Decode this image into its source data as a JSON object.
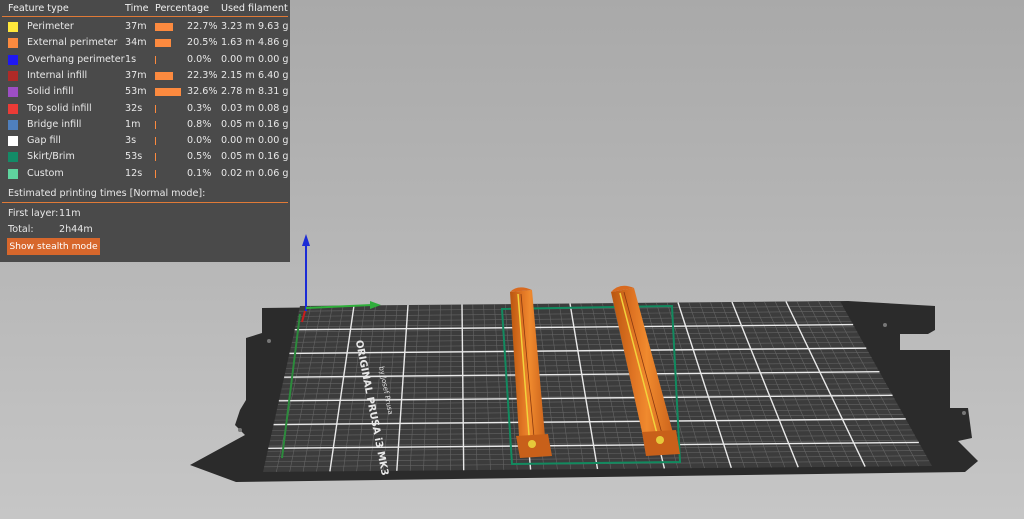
{
  "legend": {
    "headers": {
      "feature_type": "Feature type",
      "time": "Time",
      "percentage": "Percentage",
      "used_filament": "Used filament"
    },
    "rows": [
      {
        "name": "Perimeter",
        "color": "#ffe83b",
        "time": "37m",
        "percent": "22.7%",
        "length": "3.23 m",
        "weight": "9.63 g"
      },
      {
        "name": "External perimeter",
        "color": "#fc8a3f",
        "time": "34m",
        "percent": "20.5%",
        "length": "1.63 m",
        "weight": "4.86 g"
      },
      {
        "name": "Overhang perimeter",
        "color": "#1f18f0",
        "time": "1s",
        "percent": "0.0%",
        "length": "0.00 m",
        "weight": "0.00 g"
      },
      {
        "name": "Internal infill",
        "color": "#b02a27",
        "time": "37m",
        "percent": "22.3%",
        "length": "2.15 m",
        "weight": "6.40 g"
      },
      {
        "name": "Solid infill",
        "color": "#9d4ec4",
        "time": "53m",
        "percent": "32.6%",
        "length": "2.78 m",
        "weight": "8.31 g"
      },
      {
        "name": "Top solid infill",
        "color": "#eb3b36",
        "time": "32s",
        "percent": "0.3%",
        "length": "0.03 m",
        "weight": "0.08 g"
      },
      {
        "name": "Bridge infill",
        "color": "#4f7fbd",
        "time": "1m",
        "percent": "0.8%",
        "length": "0.05 m",
        "weight": "0.16 g"
      },
      {
        "name": "Gap fill",
        "color": "#ffffff",
        "time": "3s",
        "percent": "0.0%",
        "length": "0.00 m",
        "weight": "0.00 g"
      },
      {
        "name": "Skirt/Brim",
        "color": "#138b67",
        "time": "53s",
        "percent": "0.5%",
        "length": "0.05 m",
        "weight": "0.16 g"
      },
      {
        "name": "Custom",
        "color": "#5fd49e",
        "time": "12s",
        "percent": "0.1%",
        "length": "0.02 m",
        "weight": "0.06 g"
      }
    ],
    "estimate_title": "Estimated printing times [Normal mode]:",
    "first_layer_label": "First layer:",
    "first_layer_value": "11m",
    "total_label": "Total:",
    "total_value": "2h44m",
    "stealth_button": "Show stealth mode"
  },
  "bed": {
    "logo_line1": "ORIGINAL PRUSA i3 MK3",
    "logo_line2": "by Josef Prusa"
  },
  "colors": {
    "accent": "#e07a37",
    "panel_bg": "#464646",
    "bar": "#fc8a3f",
    "model": "#d9691f",
    "bed_dark": "#2e2e2e",
    "bed_sheet": "#3a3a3a",
    "axis_x": "#2fae3b",
    "axis_y": "#c81e1e",
    "axis_z": "#1a2bd6"
  }
}
